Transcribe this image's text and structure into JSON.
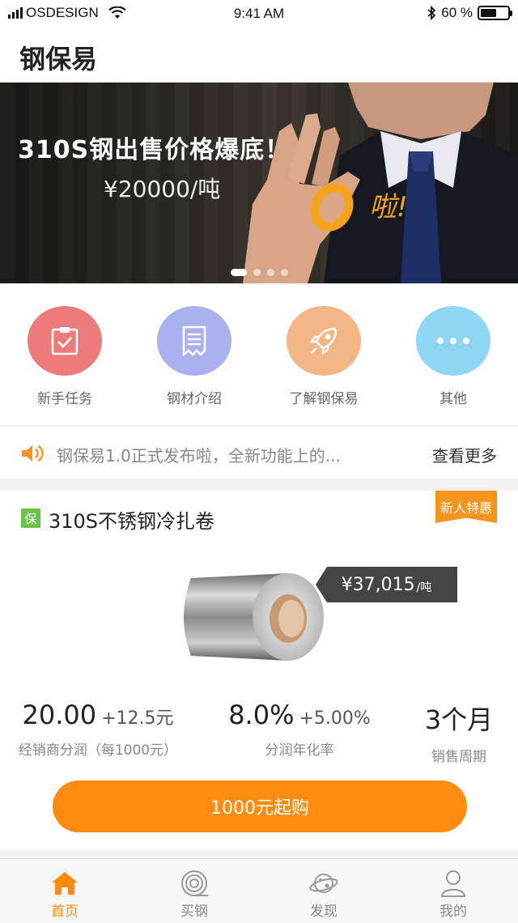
{
  "status_bar": {
    "carrier": "OSDESIGN",
    "time": "9:41 AM",
    "battery": "60 %",
    "battery_level": 0.6
  },
  "header": {
    "title": "钢保易"
  },
  "banner": {
    "title": "310S钢出售价格爆底！",
    "price": "¥20000/吨",
    "exclaim": "啦!",
    "slide_count": 4,
    "active_slide": 1
  },
  "quick_nav": [
    {
      "label": "新手任务",
      "icon": "clipboard-check-icon",
      "color": "#ee7b7b"
    },
    {
      "label": "钢材介绍",
      "icon": "document-list-icon",
      "color": "#aab1ef"
    },
    {
      "label": "了解钢保易",
      "icon": "rocket-icon",
      "color": "#f1b586"
    },
    {
      "label": "其他",
      "icon": "more-dots-icon",
      "color": "#8ed6f3"
    }
  ],
  "notice": {
    "icon": "speaker-icon",
    "text": "钢保易1.0正式发布啦，全新功能上的...",
    "more": "查看更多"
  },
  "product": {
    "badge": "保",
    "name": "310S不锈钢冷扎卷",
    "promo_tag": "新人特惠",
    "price": "¥37,015",
    "price_unit": "/吨",
    "stats": [
      {
        "value": "20.00",
        "extra": "+12.5元",
        "label": "经销商分润（每1000元）"
      },
      {
        "value": "8.0%",
        "extra": "+5.00%",
        "label": "分润年化率"
      },
      {
        "value": "3个月",
        "extra": "",
        "label": "销售周期"
      }
    ],
    "buy_label": "1000元起购"
  },
  "tab_bar": [
    {
      "label": "首页",
      "icon": "home-icon",
      "active": true
    },
    {
      "label": "买钢",
      "icon": "coil-icon",
      "active": false
    },
    {
      "label": "发现",
      "icon": "planet-icon",
      "active": false
    },
    {
      "label": "我的",
      "icon": "user-icon",
      "active": false
    }
  ],
  "colors": {
    "accent": "#ff8c0f",
    "badge_green": "#6cc24a",
    "promo": "#f7941d"
  }
}
